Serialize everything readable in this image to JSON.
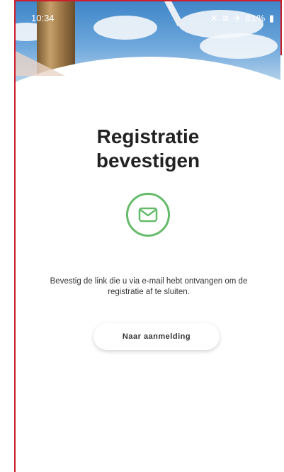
{
  "status_bar": {
    "time": "10:34",
    "battery": "81%",
    "icons": [
      "mute-icon",
      "wifi-icon",
      "airplane-icon",
      "battery-icon"
    ]
  },
  "page": {
    "title_line1": "Registratie",
    "title_line2": "bevestigen",
    "icon": "mail-icon",
    "message": "Bevestig de link die u via e-mail hebt ontvangen om de registratie af te sluiten."
  },
  "actions": {
    "login_button_label": "Naar aanmelding"
  },
  "colors": {
    "accent_green": "#66bb6a",
    "frame_red": "#cc1f2d",
    "text_dark": "#222222"
  }
}
